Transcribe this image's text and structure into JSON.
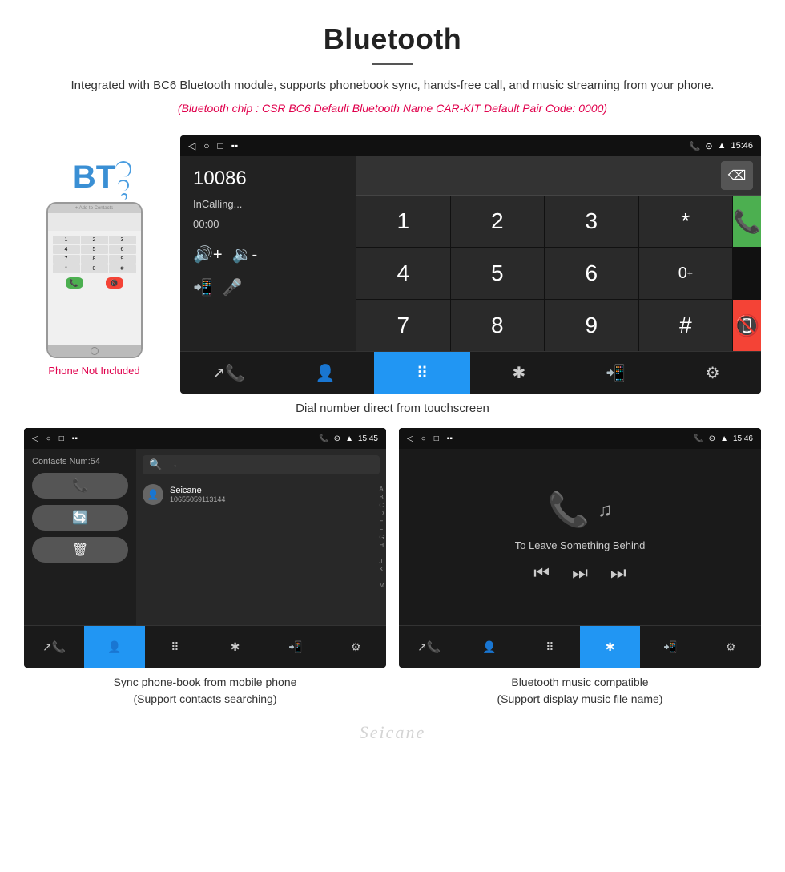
{
  "page": {
    "title": "Bluetooth",
    "divider": true,
    "description": "Integrated with BC6 Bluetooth module, supports phonebook sync, hands-free call, and music streaming from your phone.",
    "specs": "(Bluetooth chip : CSR BC6    Default Bluetooth Name CAR-KIT    Default Pair Code: 0000)",
    "phone_not_included": "Phone Not Included",
    "dial_caption": "Dial number direct from touchscreen",
    "contacts_caption_line1": "Sync phone-book from mobile phone",
    "contacts_caption_line2": "(Support contacts searching)",
    "music_caption_line1": "Bluetooth music compatible",
    "music_caption_line2": "(Support display music file name)",
    "watermark": "Seicane"
  },
  "status_bar": {
    "time": "15:46",
    "time2": "15:45",
    "time3": "15:46",
    "icons_left": [
      "back",
      "home",
      "recent",
      "notification"
    ],
    "icons_right": [
      "phone",
      "location",
      "wifi",
      "battery"
    ]
  },
  "dialer": {
    "number": "10086",
    "status": "InCalling...",
    "timer": "00:00",
    "vol_up": "🔊+",
    "vol_down": "🔉-",
    "transfer": "📲",
    "mic": "🎤",
    "keys": [
      "1",
      "2",
      "3",
      "*",
      "",
      "4",
      "5",
      "6",
      "0+",
      "",
      "7",
      "8",
      "9",
      "#",
      ""
    ],
    "call_green": "📞",
    "call_end": "📞",
    "backspace": "⌫"
  },
  "bottom_nav": {
    "items": [
      "call-transfer",
      "contacts",
      "dialpad",
      "bluetooth",
      "phone-transfer",
      "settings"
    ],
    "active_index": 2
  },
  "contacts_screen": {
    "contacts_num": "Contacts Num:54",
    "contact_name": "Seicane",
    "contact_phone": "10655059113144",
    "alphabet": [
      "A",
      "B",
      "C",
      "D",
      "E",
      "F",
      "G",
      "H",
      "I",
      "J",
      "K",
      "L",
      "M"
    ]
  },
  "music_screen": {
    "song_title": "To Leave Something Behind",
    "controls": [
      "prev",
      "play-pause",
      "next"
    ]
  }
}
